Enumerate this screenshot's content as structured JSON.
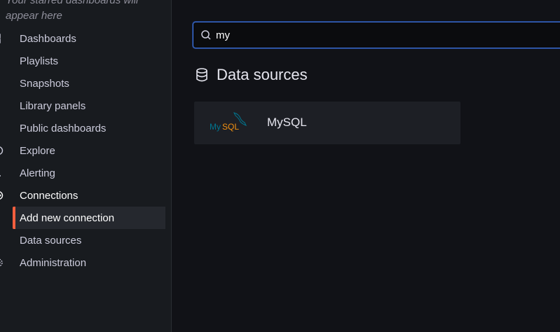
{
  "sidebar": {
    "starred_hint": "Your starred dashboards will appear here",
    "items": [
      {
        "label": "Dashboards",
        "icon": "dashboards-grid-icon"
      },
      {
        "label": "Playlists"
      },
      {
        "label": "Snapshots"
      },
      {
        "label": "Library panels"
      },
      {
        "label": "Public dashboards"
      },
      {
        "label": "Explore",
        "icon": "compass-icon"
      },
      {
        "label": "Alerting",
        "icon": "bell-icon"
      },
      {
        "label": "Connections",
        "icon": "connections-icon"
      },
      {
        "label": "Add new connection",
        "active": true
      },
      {
        "label": "Data sources"
      },
      {
        "label": "Administration",
        "icon": "gear-icon"
      }
    ],
    "active_color": "#f55f3e"
  },
  "search": {
    "value": "my"
  },
  "results": {
    "section_title": "Data sources",
    "items": [
      {
        "name": "MySQL",
        "logo_text": "MySQL"
      }
    ]
  }
}
